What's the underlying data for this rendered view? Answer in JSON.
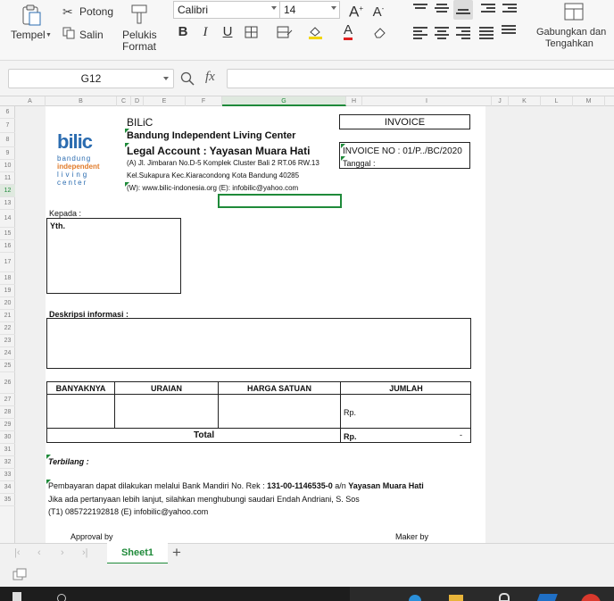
{
  "ribbon": {
    "tempel": "Tempel",
    "potong": "Potong",
    "salin": "Salin",
    "pelukis_line1": "Pelukis",
    "pelukis_line2": "Format",
    "font_name": "Calibri",
    "font_size": "14",
    "bold": "B",
    "italic": "I",
    "underline": "U",
    "font_color_glyph": "A",
    "grow_font": "A",
    "shrink_font": "A",
    "merge_line1": "Gabungkan dan",
    "merge_line2": "Tengahkan"
  },
  "formula_bar": {
    "cell_ref": "G12",
    "fx": "fx",
    "value": ""
  },
  "columns": [
    "A",
    "B",
    "C",
    "D",
    "E",
    "F",
    "G",
    "H",
    "I",
    "J",
    "K",
    "L",
    "M"
  ],
  "rows": [
    "6",
    "7",
    "8",
    "9",
    "10",
    "11",
    "12",
    "13",
    "14",
    "15",
    "16",
    "17",
    "18",
    "19",
    "20",
    "21",
    "22",
    "23",
    "24",
    "25",
    "26",
    "27",
    "28",
    "29",
    "30",
    "31",
    "32",
    "33",
    "34",
    "35"
  ],
  "invoice": {
    "logo_main": "bilic",
    "logo_sub1": "bandung",
    "logo_sub2": "independent",
    "logo_sub3": "living",
    "logo_sub4": "center",
    "company_short": "BILiC",
    "company_name": "Bandung Independent Living Center",
    "legal_account": "Legal Account : Yayasan Muara Hati",
    "address1": "(A) Jl. Jimbaran No.D-5 Komplek Cluster Bali 2 RT.06 RW.13",
    "address2": "Kel.Sukapura Kec.Kiaracondong Kota Bandung 40285",
    "web_email": "(W): www.bilic-indonesia.org (E): infobilic@yahoo.com",
    "invoice_title": "INVOICE",
    "invoice_no": "INVOICE NO : 01/P../BC/2020",
    "tanggal": "Tanggal       :",
    "kepada": "Kepada :",
    "yth": "Yth.",
    "deskripsi": "Deskripsi informasi :",
    "col_banyaknya": "BANYAKNYA",
    "col_uraian": "URAIAN",
    "col_harga": "HARGA SATUAN",
    "col_jumlah": "JUMLAH",
    "rp1": "Rp.",
    "total": "Total",
    "rp2": "Rp.",
    "dash": "-",
    "terbilang": "Terbilang :",
    "payment_prefix": "Pembayaran dapat dilakukan melalui Bank Mandiri No. Rek : ",
    "account_no": "131-00-1146535-0",
    "payment_an": " a/n ",
    "account_name": "Yayasan Muara Hati",
    "contact1": "Jika ada pertanyaan lebih  lanjut, silahkan menghubungi saudari Endah Andriani, S. Sos",
    "contact2": "(T1) 085722192818 (E) infobilic@yahoo.com",
    "approval": "Approval by",
    "maker": "Maker by"
  },
  "sheet_tab": "Sheet1",
  "colors": {
    "accent": "#1f8a3a",
    "logo_blue": "#2b6cb0",
    "logo_orange": "#e07b2a"
  }
}
